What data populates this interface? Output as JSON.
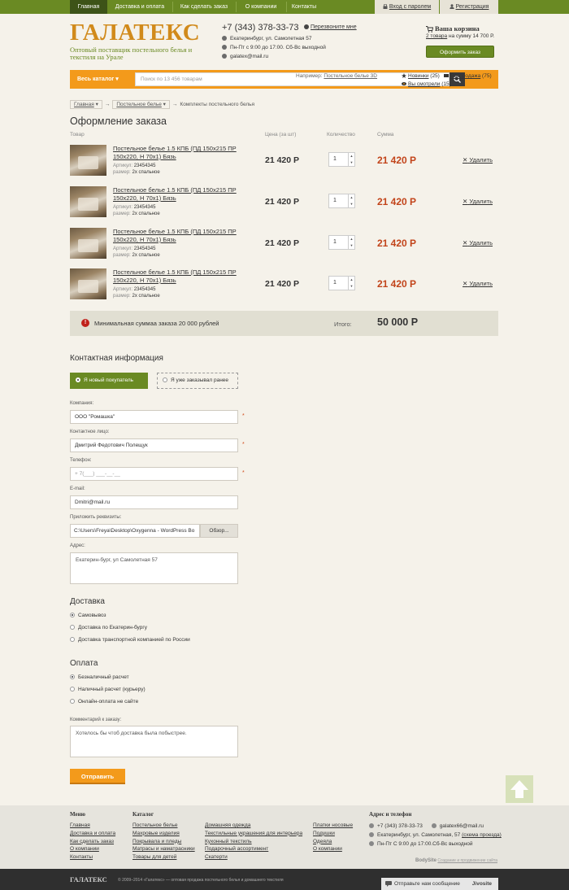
{
  "nav": {
    "items": [
      "Главная",
      "Доставка и оплата",
      "Как сделать заказ",
      "О компании",
      "Контакты"
    ],
    "login": "Вход с паролем",
    "register": "Регистрация"
  },
  "header": {
    "logo": "ГАЛАТЕКС",
    "tagline": "Оптовый поставщик постельного белья и текстиля на Урале",
    "phone": "+7 (343) 378-33-73",
    "callback": "Перезвоните мне",
    "address": "Екатеринбург, ул. Самолетная 57",
    "hours": "Пн-Пт с 9:00 до 17:00. Сб-Вс выходной",
    "email": "galatex@mail.ru",
    "cart_title": "Ваша корзина",
    "cart_items": "2 товара",
    "cart_sum": "на сумму 14 700 Р.",
    "checkout_button": "Оформить заказ"
  },
  "search": {
    "catalog": "Весь каталог",
    "placeholder": "Поиск по 13 456 товарам",
    "hint_prefix": "Например: ",
    "hint_link": "Постельное белье 3D",
    "new": "Новинки",
    "new_count": "(25)",
    "sale": "Распродажа",
    "sale_count": "(75)",
    "viewed": "Вы смотрели",
    "viewed_count": "(15)"
  },
  "breadcrumb": [
    "Главная",
    "Постельное белье",
    "Комплекты постельного белья"
  ],
  "order": {
    "title": "Оформление заказа",
    "columns": {
      "product": "Товар",
      "price": "Цена (за шт)",
      "qty": "Количество",
      "sum": "Сумма"
    },
    "items": [
      {
        "name": "Постельное белье 1.5 КПБ (ПД 150х215 ПР 150х220, Н 70х1) Бязь",
        "sku_label": "Артикул:",
        "sku": "23454345",
        "size_label": "размер:",
        "size": "2х спальное",
        "price": "21 420 Р",
        "qty": "1",
        "sum": "21 420 Р",
        "remove": "Удалить"
      },
      {
        "name": "Постельное белье 1.5 КПБ (ПД 150х215 ПР 150х220, Н 70х1) Бязь",
        "sku_label": "Артикул:",
        "sku": "23454345",
        "size_label": "размер:",
        "size": "2х спальное",
        "price": "21 420 Р",
        "qty": "1",
        "sum": "21 420 Р",
        "remove": "Удалить"
      },
      {
        "name": "Постельное белье 1.5 КПБ (ПД 150х215 ПР 150х220, Н 70х1) Бязь",
        "sku_label": "Артикул:",
        "sku": "23454345",
        "size_label": "размер:",
        "size": "2х спальное",
        "price": "21 420 Р",
        "qty": "1",
        "sum": "21 420 Р",
        "remove": "Удалить"
      },
      {
        "name": "Постельное белье 1.5 КПБ (ПД 150х215 ПР 150х220, Н 70х1) Бязь",
        "sku_label": "Артикул:",
        "sku": "23454345",
        "size_label": "размер:",
        "size": "2х спальное",
        "price": "21 420 Р",
        "qty": "1",
        "sum": "21 420 Р",
        "remove": "Удалить"
      }
    ],
    "min_warning": "Минимальная суммаа заказа 20 000 рублей",
    "total_label": "Итого:",
    "total_value": "50 000 Р"
  },
  "contact": {
    "title": "Контактная информация",
    "tab_new": "Я новый покупатель",
    "tab_old": "Я уже заказывал ранее",
    "company_label": "Компания:",
    "company_value": "ООО \"Ромашка\"",
    "person_label": "Контактное лицо:",
    "person_value": "Дмитрий Федотович Полещук",
    "phone_label": "Телефон:",
    "phone_placeholder": "+ 7(___) ___-__-__",
    "email_label": "E-mail:",
    "email_value": "Dmitri@mail.ru",
    "file_label": "Приложить реквизиты:",
    "file_value": "C:\\Users\\Freya\\Desktop\\Oxygenna - WordPress Bo",
    "file_button": "Обзор...",
    "address_label": "Адрес:",
    "address_value": "Екатерин-бург, ул Самолетная 57"
  },
  "delivery": {
    "title": "Доставка",
    "options": [
      "Самовывоз",
      "Доставка по Екатерин-бургу",
      "Доставка транспортной компанией по России"
    ]
  },
  "payment": {
    "title": "Оплата",
    "options": [
      "Безналичный расчет",
      "Наличный расчет (курьеру)",
      "Онлайн-оплата не сайте"
    ],
    "comment_label": "Комментарий к заказу:",
    "comment_value": "Хотелось бы чтоб доставка была побыстрее.",
    "submit": "Отправить"
  },
  "footer": {
    "menu_title": "Меню",
    "menu": [
      "Главная",
      "Доставка и оплата",
      "Как сделать заказ",
      "О компании",
      "Контакты"
    ],
    "catalog_title": "Каталог",
    "catalog_col1": [
      "Постельное белье",
      "Махровые изделия",
      "Покрывала и пледы",
      "Матрасы и наматрасники",
      "Товары для детей"
    ],
    "catalog_col2": [
      "Домашняя одежда",
      "Текстильные украшения для интерьера",
      "Кухонный текстиль",
      "Подарочный ассортимент",
      "Скатерти"
    ],
    "catalog_col3": [
      "Платки носовые",
      "Подушки",
      "Одеяла",
      "О компании"
    ],
    "contacts_title": "Адрес и телефон",
    "phone": "+7 (343) 378-33-73",
    "email": "galatex66@mail.ru",
    "address": "Екатеринбург, ул. Самолетная, 57",
    "map_link": "(схема проезда)",
    "hours": "Пн-Пт С 9:00 до 17:00.Сб-Вс выходной",
    "bodysite": "BodySite",
    "bodysite_sub": "Создание и продвижение сайта",
    "bottom_logo": "ГАЛАТЕКС",
    "copyright": "© 2009–2014 «Галатекс» — оптовая продажа постельного белья и домашнего текстиля",
    "chat": "Отправьте нам сообщение",
    "chat_brand": "Jivosite"
  },
  "colors": {
    "green": "#6a8a23",
    "orange": "#f39a1b",
    "price_red": "#c2441a"
  }
}
